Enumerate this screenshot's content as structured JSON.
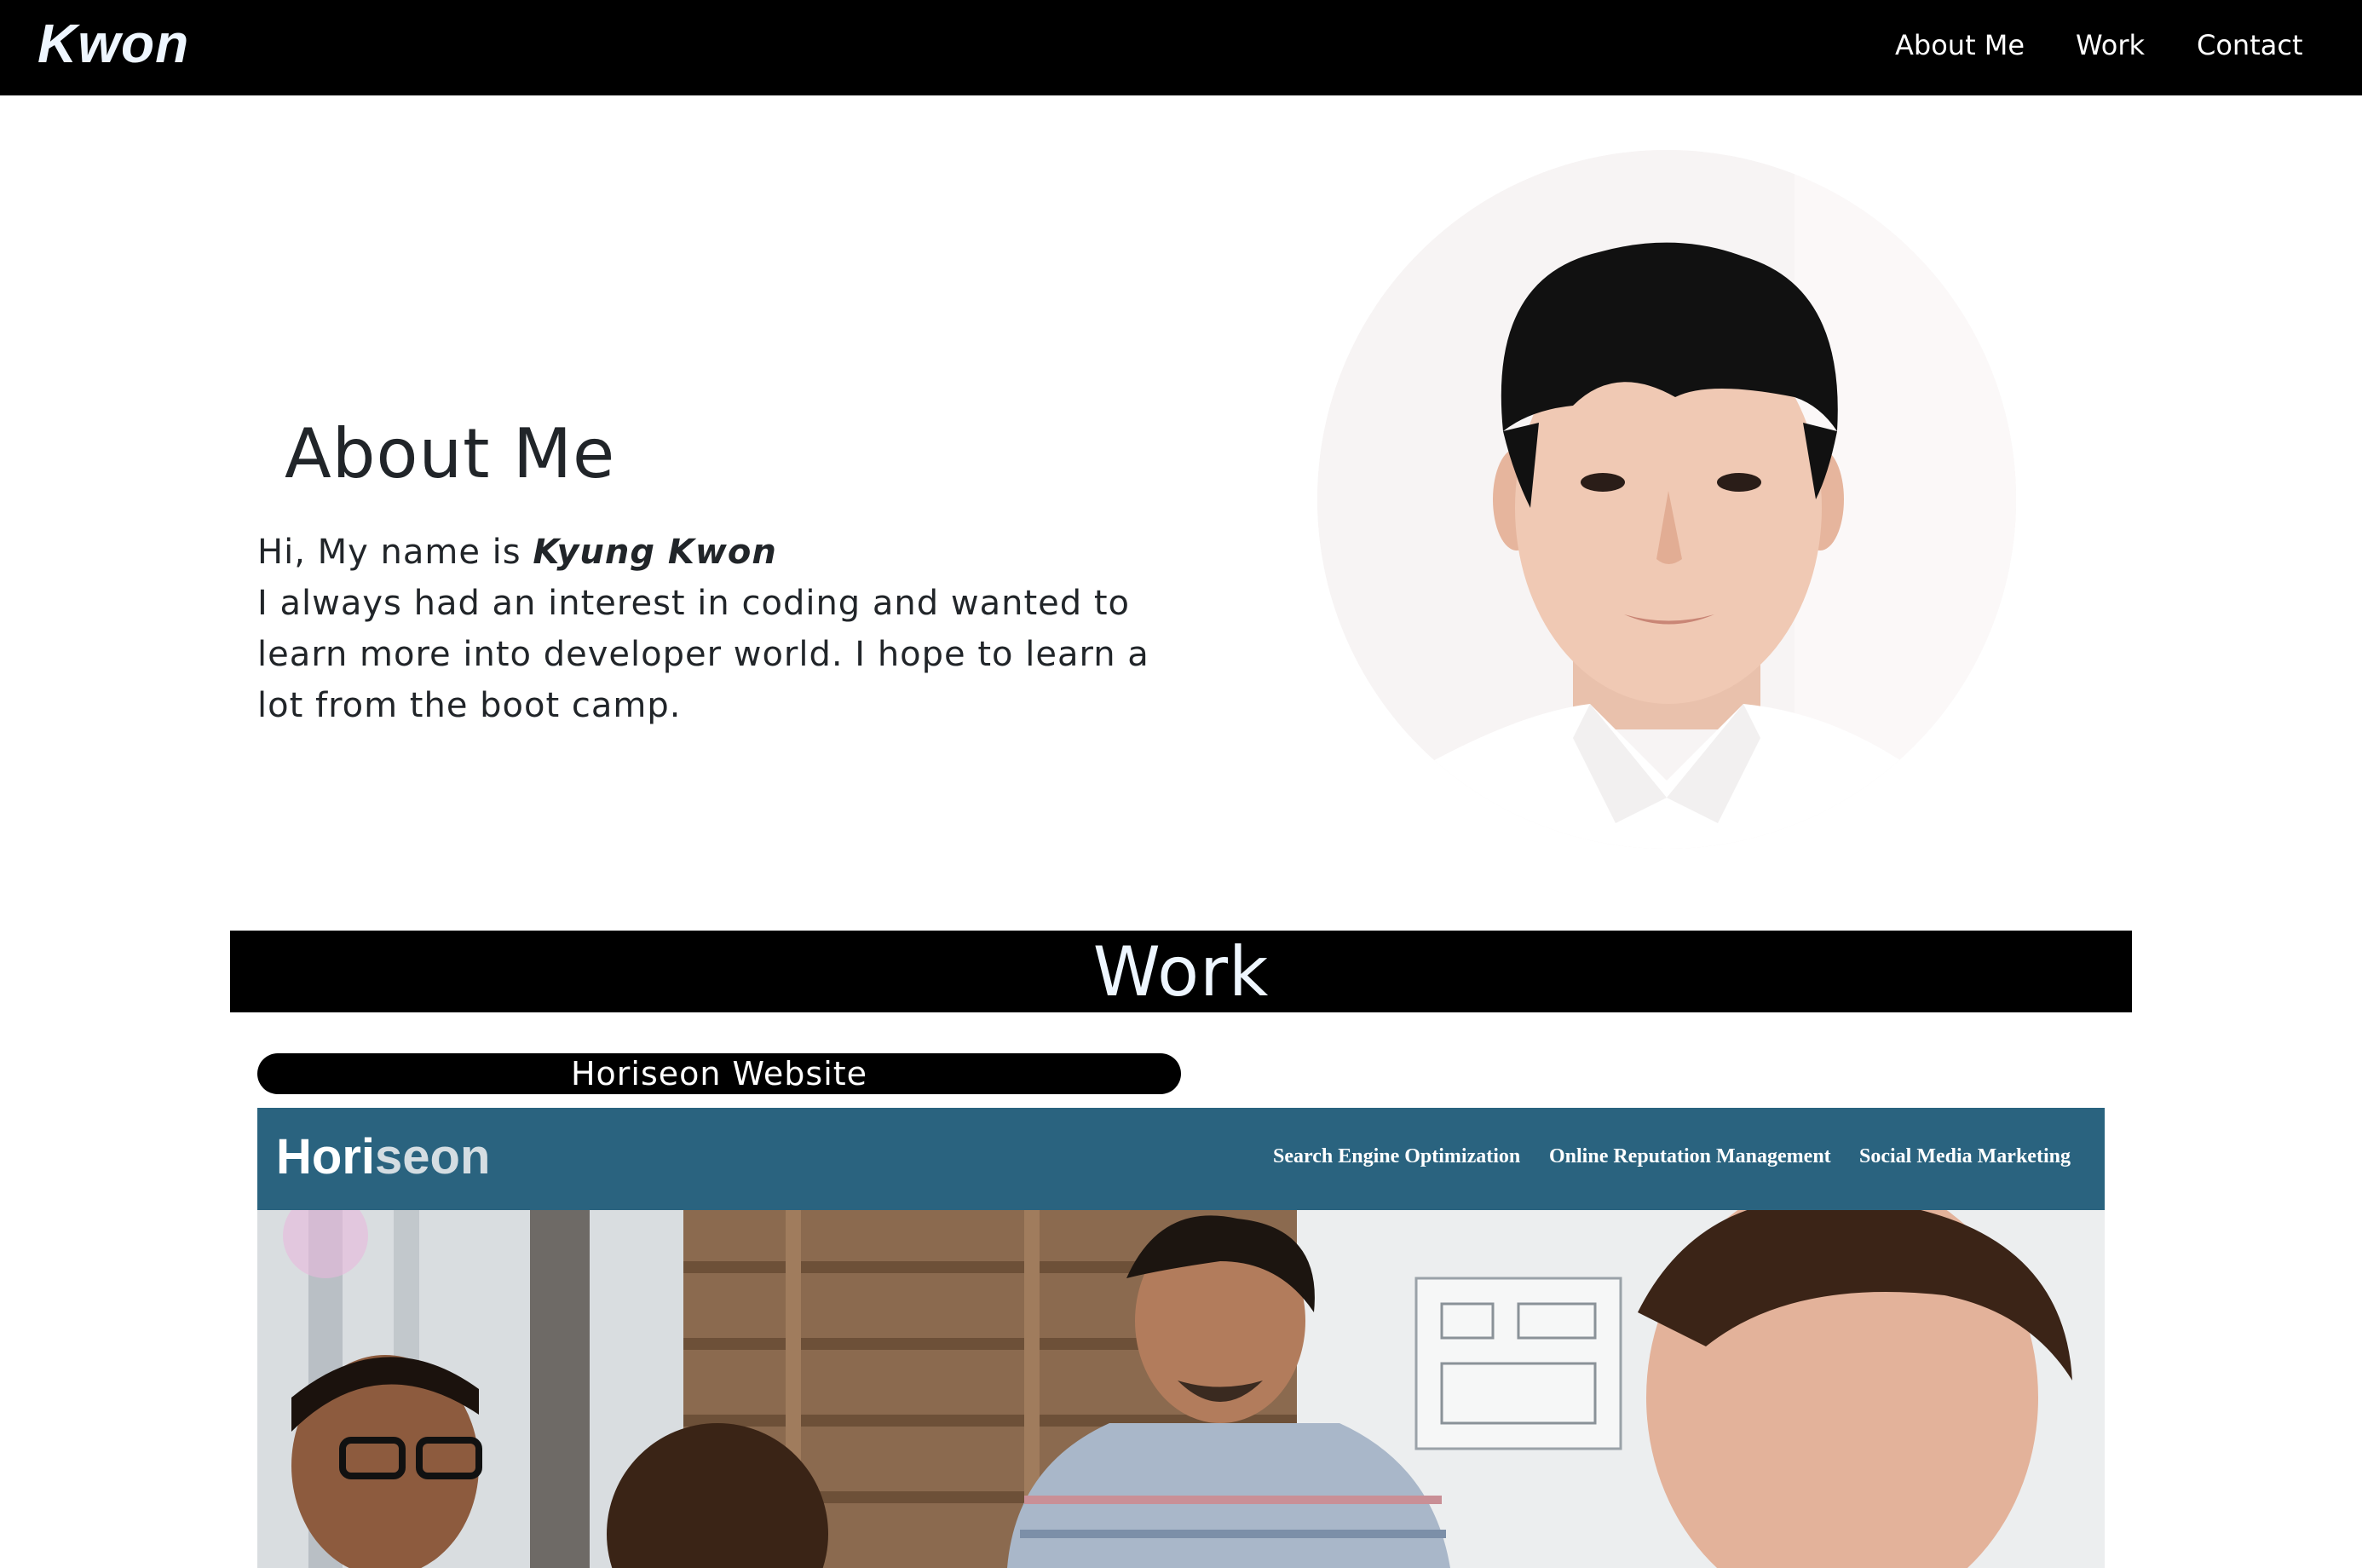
{
  "navbar": {
    "brand": "Kwon",
    "links": [
      "About Me",
      "Work",
      "Contact"
    ]
  },
  "about": {
    "title": "About Me",
    "intro_prefix": "Hi, My name is ",
    "name": "Kyung Kwon",
    "body": "I always had an interest in coding and wanted to learn more into developer world. I hope to learn a lot from the boot camp."
  },
  "work": {
    "title": "Work",
    "projects": [
      {
        "label": "Horiseon Website",
        "screenshot": {
          "logo_main": "Hori",
          "logo_accent": "seon",
          "nav": [
            "Search Engine Optimization",
            "Online Reputation Management",
            "Social Media Marketing"
          ]
        }
      }
    ]
  },
  "colors": {
    "navbar_bg": "#000000",
    "brand_text": "#eef6ff",
    "horiseon_header": "#2a637f"
  }
}
